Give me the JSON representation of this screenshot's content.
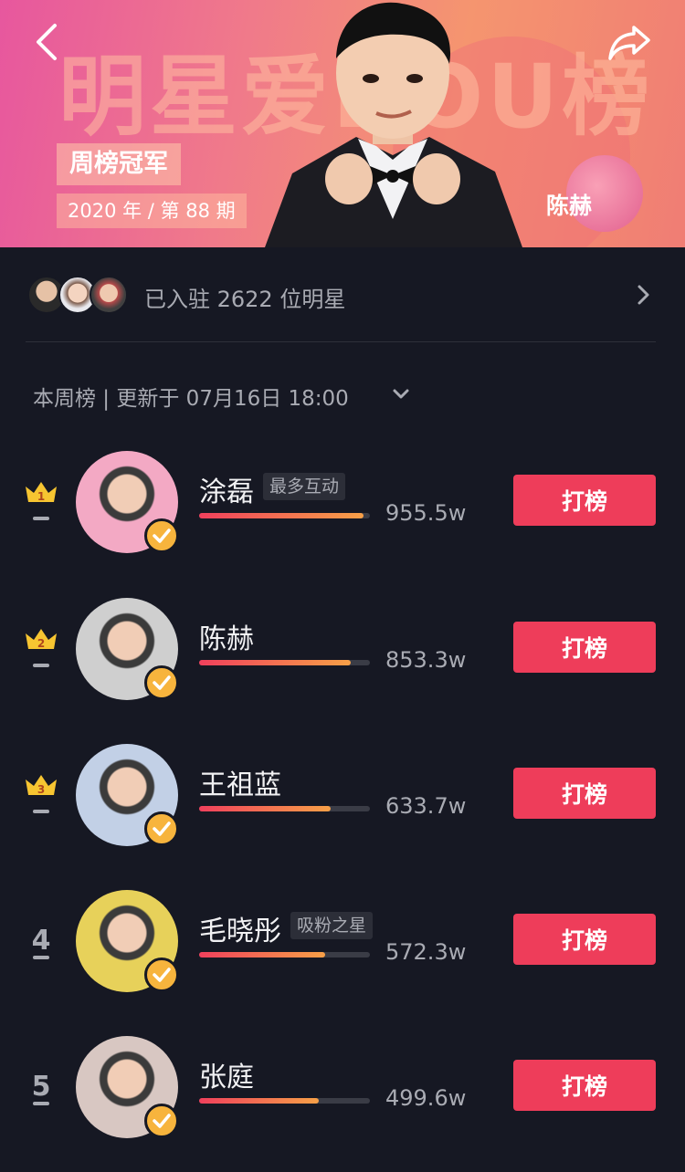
{
  "banner": {
    "title": "明星爱DOU榜",
    "champion_label": "周榜冠军",
    "period": "2020 年 / 第 88 期",
    "champion_name": "陈赫"
  },
  "icons": {
    "back": "chevron-left-icon",
    "share": "share-arrow-icon",
    "more": "chevron-right-icon",
    "dropdown": "chevron-down-icon",
    "crown": "crown-icon",
    "verified": "checkmark-icon"
  },
  "residents": {
    "text": "已入驻 2622 位明星"
  },
  "update": {
    "text": "本周榜 | 更新于 07月16日 18:00"
  },
  "colors": {
    "background": "#161823",
    "vote_button": "#ee3d5a",
    "verify_badge": "#f7b43d",
    "crown": "#f7c531"
  },
  "ranking": [
    {
      "rank": "1",
      "crown": true,
      "name": "涂磊",
      "tag": "最多互动",
      "score": "955.5w",
      "progress": 0.96,
      "button": "打榜",
      "avatar_color": "#f3a9c4"
    },
    {
      "rank": "2",
      "crown": true,
      "name": "陈赫",
      "tag": "",
      "score": "853.3w",
      "progress": 0.89,
      "button": "打榜",
      "avatar_color": "#cfcfcf"
    },
    {
      "rank": "3",
      "crown": true,
      "name": "王祖蓝",
      "tag": "",
      "score": "633.7w",
      "progress": 0.77,
      "button": "打榜",
      "avatar_color": "#c2d0e6"
    },
    {
      "rank": "4",
      "crown": false,
      "name": "毛晓彤",
      "tag": "吸粉之星",
      "score": "572.3w",
      "progress": 0.74,
      "button": "打榜",
      "avatar_color": "#e7d15a"
    },
    {
      "rank": "5",
      "crown": false,
      "name": "张庭",
      "tag": "",
      "score": "499.6w",
      "progress": 0.7,
      "button": "打榜",
      "avatar_color": "#d8c7c2"
    }
  ]
}
